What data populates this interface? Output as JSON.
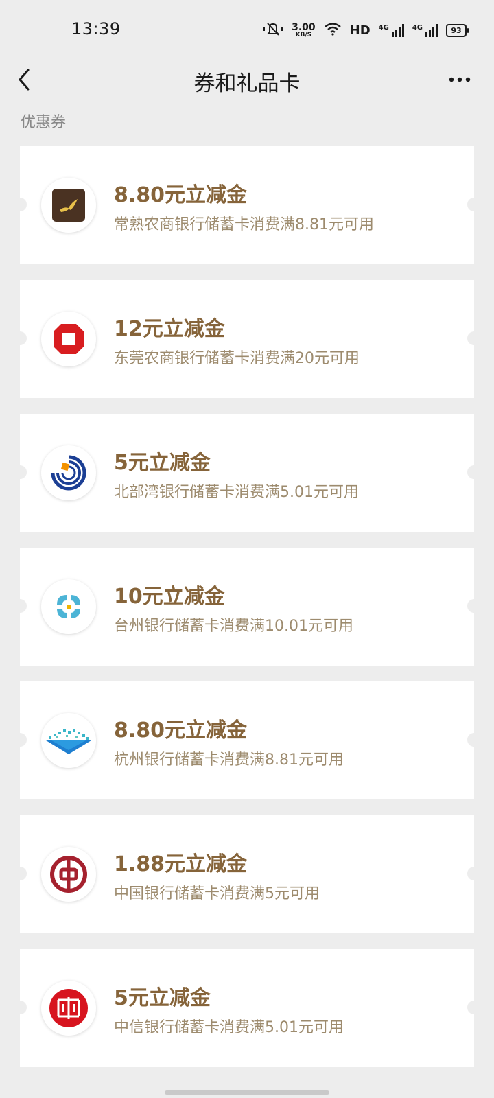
{
  "status_bar": {
    "time": "13:39",
    "net_speed_value": "3.00",
    "net_speed_unit": "KB/S",
    "hd_label": "HD",
    "signal_1_label": "4G",
    "signal_2_label": "4G",
    "battery_level": "93",
    "icons": [
      "mute-icon",
      "wifi-icon",
      "signal-icon",
      "battery-icon"
    ]
  },
  "nav": {
    "title": "券和礼品卡",
    "back_icon": "back-arrow-icon",
    "more_icon": "more-icon"
  },
  "section": {
    "label": "优惠券"
  },
  "coupons": [
    {
      "title": "8.80元立减金",
      "desc": "常熟农商银行储蓄卡消费满8.81元可用",
      "logo": "changshu-rural-bank-logo"
    },
    {
      "title": "12元立减金",
      "desc": "东莞农商银行储蓄卡消费满20元可用",
      "logo": "dongguan-rural-bank-logo"
    },
    {
      "title": "5元立减金",
      "desc": "北部湾银行储蓄卡消费满5.01元可用",
      "logo": "beibu-gulf-bank-logo"
    },
    {
      "title": "10元立减金",
      "desc": "台州银行储蓄卡消费满10.01元可用",
      "logo": "taizhou-bank-logo"
    },
    {
      "title": "8.80元立减金",
      "desc": "杭州银行储蓄卡消费满8.81元可用",
      "logo": "hangzhou-bank-logo"
    },
    {
      "title": "1.88元立减金",
      "desc": "中国银行储蓄卡消费满5元可用",
      "logo": "bank-of-china-logo"
    },
    {
      "title": "5元立减金",
      "desc": "中信银行储蓄卡消费满5.01元可用",
      "logo": "citic-bank-logo"
    }
  ],
  "colors": {
    "background": "#ededed",
    "coupon_title": "#86643a",
    "coupon_desc": "#9d8b6e"
  }
}
